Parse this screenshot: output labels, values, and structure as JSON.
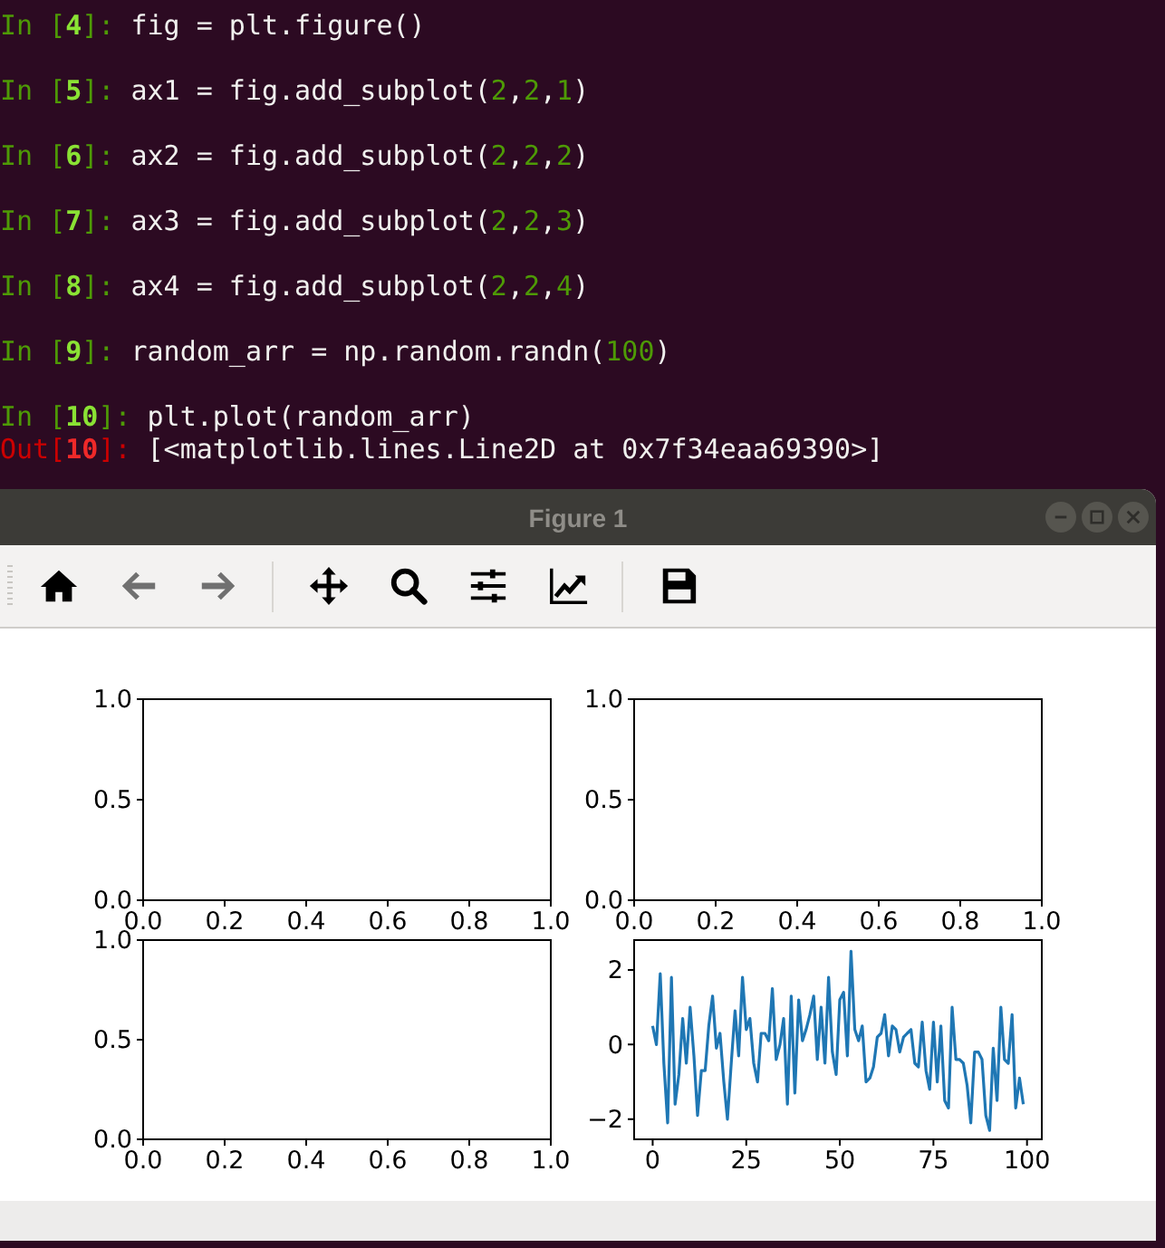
{
  "terminal": {
    "lines": [
      {
        "kind": "in",
        "prompt": "In [**4**]:",
        "code": [
          {
            "kind": "plain",
            "text": "fig = plt.figure()"
          }
        ]
      },
      {
        "kind": "in",
        "prompt": "In [**5**]:",
        "code": [
          {
            "kind": "plain",
            "text": "ax1 = fig.add_subplot("
          },
          {
            "kind": "number",
            "text": "2"
          },
          {
            "kind": "plain",
            "text": ","
          },
          {
            "kind": "number",
            "text": "2"
          },
          {
            "kind": "plain",
            "text": ","
          },
          {
            "kind": "number",
            "text": "1"
          },
          {
            "kind": "plain",
            "text": ")"
          }
        ]
      },
      {
        "kind": "in",
        "prompt": "In [**6**]:",
        "code": [
          {
            "kind": "plain",
            "text": "ax2 = fig.add_subplot("
          },
          {
            "kind": "number",
            "text": "2"
          },
          {
            "kind": "plain",
            "text": ","
          },
          {
            "kind": "number",
            "text": "2"
          },
          {
            "kind": "plain",
            "text": ","
          },
          {
            "kind": "number",
            "text": "2"
          },
          {
            "kind": "plain",
            "text": ")"
          }
        ]
      },
      {
        "kind": "in",
        "prompt": "In [**7**]:",
        "code": [
          {
            "kind": "plain",
            "text": "ax3 = fig.add_subplot("
          },
          {
            "kind": "number",
            "text": "2"
          },
          {
            "kind": "plain",
            "text": ","
          },
          {
            "kind": "number",
            "text": "2"
          },
          {
            "kind": "plain",
            "text": ","
          },
          {
            "kind": "number",
            "text": "3"
          },
          {
            "kind": "plain",
            "text": ")"
          }
        ]
      },
      {
        "kind": "in",
        "prompt": "In [**8**]:",
        "code": [
          {
            "kind": "plain",
            "text": "ax4 = fig.add_subplot("
          },
          {
            "kind": "number",
            "text": "2"
          },
          {
            "kind": "plain",
            "text": ","
          },
          {
            "kind": "number",
            "text": "2"
          },
          {
            "kind": "plain",
            "text": ","
          },
          {
            "kind": "number",
            "text": "4"
          },
          {
            "kind": "plain",
            "text": ")"
          }
        ]
      },
      {
        "kind": "in",
        "prompt": "In [**9**]:",
        "code": [
          {
            "kind": "plain",
            "text": "random_arr = np.random.randn("
          },
          {
            "kind": "number",
            "text": "100"
          },
          {
            "kind": "plain",
            "text": ")"
          }
        ]
      },
      {
        "kind": "in",
        "prompt": "In [**10**]:",
        "code": [
          {
            "kind": "plain",
            "text": "plt.plot(random_arr)"
          }
        ]
      },
      {
        "kind": "out",
        "prompt": "Out[**10**]:",
        "code": [
          {
            "kind": "plain",
            "text": "[<matplotlib.lines.Line2D at 0x7f34eaa69390>]"
          }
        ]
      }
    ]
  },
  "window": {
    "title": "Figure 1",
    "toolbar": [
      [
        {
          "kind": "home",
          "disabled": false
        },
        {
          "kind": "back",
          "disabled": true
        },
        {
          "kind": "forward",
          "disabled": true
        }
      ],
      [
        {
          "kind": "pan",
          "disabled": false
        },
        {
          "kind": "zoom",
          "disabled": false
        },
        {
          "kind": "subplots",
          "disabled": false
        },
        {
          "kind": "customize",
          "disabled": false
        }
      ],
      [
        {
          "kind": "save",
          "disabled": false
        }
      ]
    ],
    "axes": [
      {
        "chart_data": {
          "type": "line",
          "xlim": [
            0,
            1
          ],
          "ylim": [
            0,
            1
          ],
          "xticks": [
            {
              "value": 0,
              "label": "0.0"
            },
            {
              "value": 0.2,
              "label": "0.2"
            },
            {
              "value": 0.4,
              "label": "0.4"
            },
            {
              "value": 0.6,
              "label": "0.6"
            },
            {
              "value": 0.8,
              "label": "0.8"
            },
            {
              "value": 1,
              "label": "1.0"
            }
          ],
          "yticks": [
            {
              "value": 0,
              "label": "0.0"
            },
            {
              "value": 0.5,
              "label": "0.5"
            },
            {
              "value": 1,
              "label": "1.0"
            }
          ]
        }
      },
      {
        "chart_data": {
          "type": "line",
          "xlim": [
            0,
            1
          ],
          "ylim": [
            0,
            1
          ],
          "xticks": [
            {
              "value": 0,
              "label": "0.0"
            },
            {
              "value": 0.2,
              "label": "0.2"
            },
            {
              "value": 0.4,
              "label": "0.4"
            },
            {
              "value": 0.6,
              "label": "0.6"
            },
            {
              "value": 0.8,
              "label": "0.8"
            },
            {
              "value": 1,
              "label": "1.0"
            }
          ],
          "yticks": [
            {
              "value": 0,
              "label": "0.0"
            },
            {
              "value": 0.5,
              "label": "0.5"
            },
            {
              "value": 1,
              "label": "1.0"
            }
          ]
        }
      },
      {
        "chart_data": {
          "type": "line",
          "xlim": [
            0,
            1
          ],
          "ylim": [
            0,
            1
          ],
          "xticks": [
            {
              "value": 0,
              "label": "0.0"
            },
            {
              "value": 0.2,
              "label": "0.2"
            },
            {
              "value": 0.4,
              "label": "0.4"
            },
            {
              "value": 0.6,
              "label": "0.6"
            },
            {
              "value": 0.8,
              "label": "0.8"
            },
            {
              "value": 1,
              "label": "1.0"
            }
          ],
          "yticks": [
            {
              "value": 0,
              "label": "0.0"
            },
            {
              "value": 0.5,
              "label": "0.5"
            },
            {
              "value": 1,
              "label": "1.0"
            }
          ]
        }
      },
      {
        "chart_data": {
          "type": "line",
          "xlim": [
            -4.95,
            103.95
          ],
          "ylim": [
            -2.54,
            2.8
          ],
          "xticks": [
            0,
            25,
            50,
            75,
            100
          ],
          "yticks": [
            {
              "value": -2,
              "label": "−2"
            },
            {
              "value": 0,
              "label": "0"
            },
            {
              "value": 2,
              "label": "2"
            }
          ],
          "x": [
            0,
            1,
            2,
            3,
            4,
            5,
            6,
            7,
            8,
            9,
            10,
            11,
            12,
            13,
            14,
            15,
            16,
            17,
            18,
            19,
            20,
            21,
            22,
            23,
            24,
            25,
            26,
            27,
            28,
            29,
            30,
            31,
            32,
            33,
            34,
            35,
            36,
            37,
            38,
            39,
            40,
            41,
            42,
            43,
            44,
            45,
            46,
            47,
            48,
            49,
            50,
            51,
            52,
            53,
            54,
            55,
            56,
            57,
            58,
            59,
            60,
            61,
            62,
            63,
            64,
            65,
            66,
            67,
            68,
            69,
            70,
            71,
            72,
            73,
            74,
            75,
            76,
            77,
            78,
            79,
            80,
            81,
            82,
            83,
            84,
            85,
            86,
            87,
            88,
            89,
            90,
            91,
            92,
            93,
            94,
            95,
            96,
            97,
            98,
            99
          ],
          "series": [
            {
              "color": "#1f77b4",
              "values": [
                0.5,
                0,
                1.9,
                -0.5,
                -2.1,
                1.8,
                -1.6,
                -0.8,
                0.7,
                -0.5,
                1.0,
                -0.3,
                -1.9,
                -0.7,
                -0.7,
                0.5,
                1.3,
                -0.1,
                0.3,
                -1.0,
                -2.0,
                -0.5,
                0.9,
                -0.3,
                1.8,
                0.4,
                0.7,
                -0.5,
                -1.0,
                0.3,
                0.3,
                0.1,
                1.5,
                -0.4,
                0.0,
                0.7,
                -1.6,
                1.3,
                -1.3,
                1.2,
                0.1,
                0.4,
                0.8,
                1.3,
                -0.4,
                1.0,
                -0.5,
                1.8,
                -0.2,
                -0.8,
                1.2,
                1.4,
                -0.3,
                2.5,
                0.4,
                0.1,
                0.5,
                -1.0,
                -0.9,
                -0.6,
                0.2,
                0.3,
                0.8,
                -0.3,
                0.5,
                0.4,
                -0.2,
                0.2,
                0.3,
                0.4,
                -0.5,
                -0.6,
                0.6,
                -0.7,
                -1.2,
                0.6,
                -1.0,
                0.5,
                -1.5,
                -1.7,
                1.0,
                -0.4,
                -0.4,
                -0.5,
                -1.1,
                -2.1,
                -0.2,
                -0.2,
                -0.4,
                -1.9,
                -2.3,
                -0.1,
                -1.5,
                1.0,
                -0.4,
                -0.5,
                0.8,
                -1.7,
                -0.9,
                -1.6
              ]
            }
          ]
        }
      }
    ]
  }
}
